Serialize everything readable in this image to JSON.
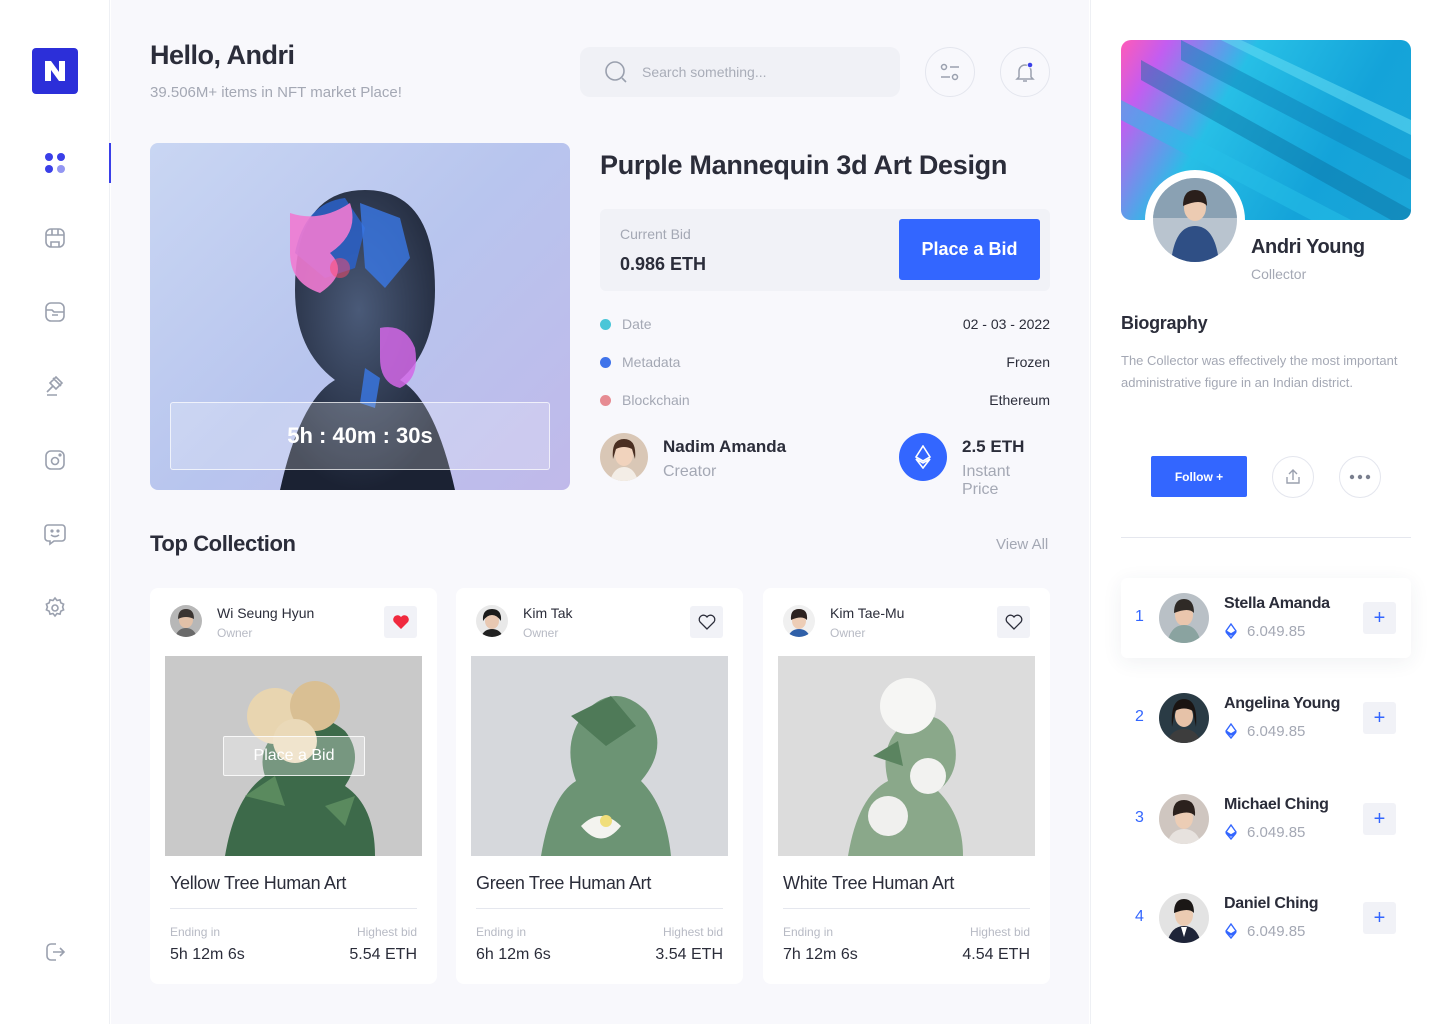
{
  "logo": {
    "letter": "N",
    "color": "#2c2fd9"
  },
  "sidebar": {
    "items": [
      {
        "name": "dashboard-icon",
        "active": true
      },
      {
        "name": "shop-icon",
        "active": false
      },
      {
        "name": "folder-icon",
        "active": false
      },
      {
        "name": "auction-icon",
        "active": false
      },
      {
        "name": "wallet-icon",
        "active": false
      },
      {
        "name": "chat-icon",
        "active": false
      },
      {
        "name": "settings-icon",
        "active": false
      }
    ],
    "logout": "logout-icon"
  },
  "header": {
    "greeting": "Hello, Andri",
    "subtitle": "39.506M+ items in NFT market Place!",
    "search_placeholder": "Search something..."
  },
  "hero": {
    "timer": "5h : 40m : 30s",
    "title": "Purple Mannequin 3d Art Design",
    "current_bid_label": "Current Bid",
    "current_bid_value": "0.986 ETH",
    "place_bid_label": "Place a Bid",
    "meta": [
      {
        "label": "Date",
        "value": "02 - 03 - 2022",
        "color": "#4ac6d8"
      },
      {
        "label": "Metadata",
        "value": "Frozen",
        "color": "#3f73ea"
      },
      {
        "label": "Blockchain",
        "value": "Ethereum",
        "color": "#e68b92"
      }
    ],
    "creator_name": "Nadim Amanda",
    "creator_role": "Creator",
    "price_value": "2.5 ETH",
    "price_label": "Instant Price"
  },
  "collection": {
    "title": "Top Collection",
    "view_all": "View All",
    "cards": [
      {
        "owner": "Wi Seung Hyun",
        "owner_role": "Owner",
        "liked": true,
        "title": "Yellow Tree Human Art",
        "ending_label": "Ending in",
        "ending": "5h 12m 6s",
        "bid_label": "Highest bid",
        "bid": "5.54 ETH",
        "hover_button": "Place a Bid"
      },
      {
        "owner": "Kim Tak",
        "owner_role": "Owner",
        "liked": false,
        "title": "Green Tree Human Art",
        "ending_label": "Ending in",
        "ending": "6h 12m 6s",
        "bid_label": "Highest bid",
        "bid": "3.54 ETH"
      },
      {
        "owner": "Kim Tae-Mu",
        "owner_role": "Owner",
        "liked": false,
        "title": "White Tree Human Art",
        "ending_label": "Ending in",
        "ending": "7h 12m 6s",
        "bid_label": "Highest bid",
        "bid": "4.54 ETH"
      }
    ]
  },
  "profile": {
    "name": "Andri Young",
    "role": "Collector",
    "bio_title": "Biography",
    "bio": "The Collector was effectively the most important administrative figure in an Indian district.",
    "follow_label": "Follow +"
  },
  "collectors": [
    {
      "rank": "1",
      "name": "Stella Amanda",
      "value": "6.049.85"
    },
    {
      "rank": "2",
      "name": "Angelina Young",
      "value": "6.049.85"
    },
    {
      "rank": "3",
      "name": "Michael Ching",
      "value": "6.049.85"
    },
    {
      "rank": "4",
      "name": "Daniel Ching",
      "value": "6.049.85"
    }
  ],
  "colors": {
    "accent": "#3366ff",
    "brand": "#2c2fd9",
    "like": "#f0293e"
  }
}
